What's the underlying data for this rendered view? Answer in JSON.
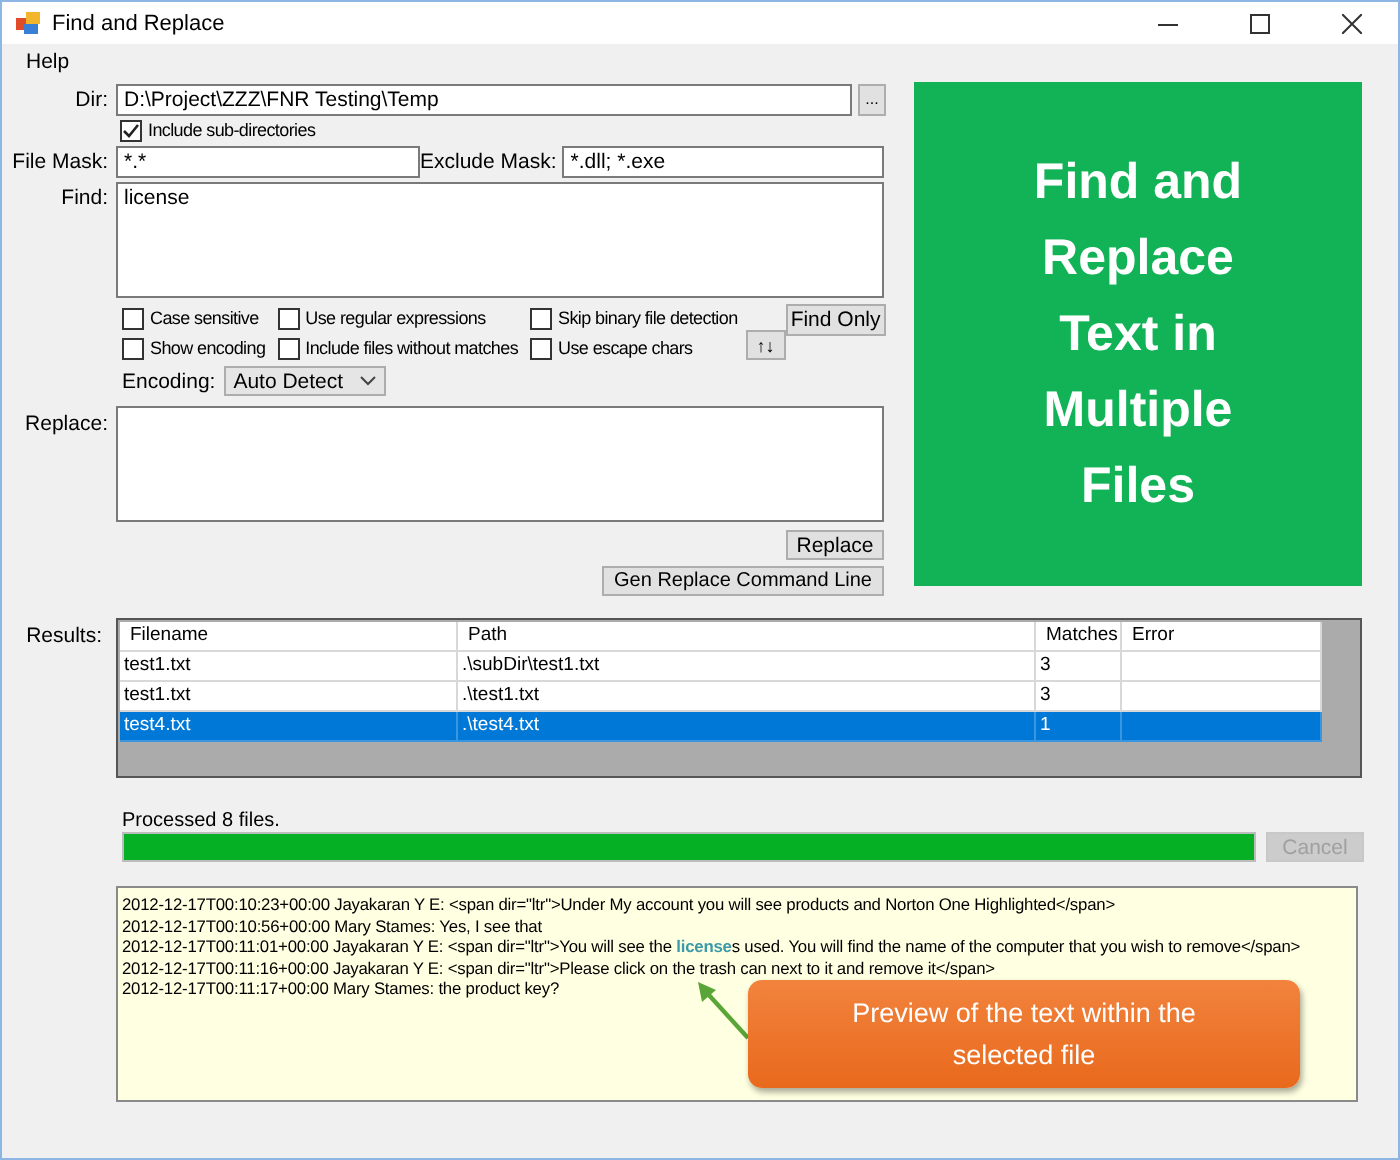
{
  "window": {
    "title": "Find and Replace"
  },
  "menu": [
    {
      "label": "Help"
    }
  ],
  "form": {
    "dir": {
      "label": "Dir:",
      "value": "D:\\Project\\ZZZ\\FNR Testing\\Temp",
      "browse": "..."
    },
    "include_subdirs": {
      "label": "Include sub-directories",
      "checked": true
    },
    "file_mask": {
      "label": "File Mask:",
      "value": "*.*"
    },
    "exclude_mask": {
      "label": "Exclude Mask:",
      "value": "*.dll; *.exe"
    },
    "find": {
      "label": "Find:",
      "value": "license"
    },
    "options": [
      {
        "label": "Case sensitive",
        "checked": false
      },
      {
        "label": "Show encoding",
        "checked": false
      },
      {
        "label": "Use regular expressions",
        "checked": false
      },
      {
        "label": "Include files without matches",
        "checked": false
      },
      {
        "label": "Skip binary file detection",
        "checked": false
      },
      {
        "label": "Use escape chars",
        "checked": false
      }
    ],
    "find_only": "Find Only",
    "swap": "↑↓",
    "encoding": {
      "label": "Encoding:",
      "value": "Auto Detect"
    },
    "replace": {
      "label": "Replace:"
    },
    "replace_button": "Replace",
    "gen_button": "Gen Replace Command Line"
  },
  "banner": {
    "title": "Find and Replace Text in Multiple Files"
  },
  "results": {
    "label": "Results:",
    "columns": [
      "Filename",
      "Path",
      "Matches",
      "Error"
    ],
    "rows": [
      {
        "cells": [
          "test1.txt",
          ".\\subDir\\test1.txt",
          "3"
        ],
        "selected": false
      },
      {
        "cells": [
          "test1.txt",
          ".\\test1.txt",
          "3"
        ],
        "selected": false
      },
      {
        "cells": [
          "test4.txt",
          ".\\test4.txt",
          "1"
        ],
        "selected": true
      }
    ]
  },
  "status": "Processed 8 files.",
  "progress": {
    "level": 1
  },
  "cancel": {
    "label": "Cancel",
    "disabled": true
  },
  "preview": {
    "lines": [
      "2012-12-17T00:10:23+00:00 Jayakaran Y E: <span dir=\"ltr\">Under My account you will see products and Norton One Highlighted</span>",
      "2012-12-17T00:10:56+00:00 Mary Stames: Yes, I see that",
      "2012-12-17T00:11:01+00:00 Jayakaran Y E: <span dir=\"ltr\">You will see the **license**s used.  You will find the name of the computer that you wish to remove</span>",
      "2012-12-17T00:11:16+00:00 Jayakaran Y E: <span dir=\"ltr\">Please click on the trash can next to it and remove it</span>",
      "2012-12-17T00:11:17+00:00 Mary Stames: the product key?"
    ]
  },
  "callout": {
    "text": "Preview of the text within the selected file"
  }
}
